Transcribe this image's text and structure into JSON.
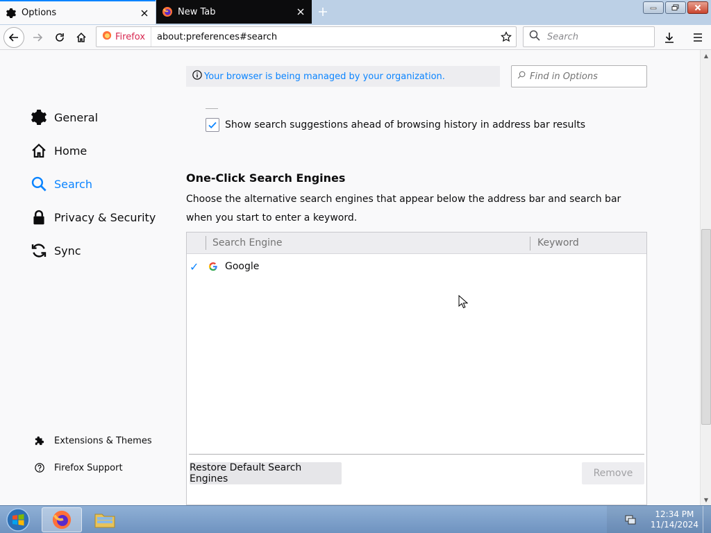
{
  "tabs": [
    {
      "label": "Options",
      "active": true
    },
    {
      "label": "New Tab",
      "active": false
    }
  ],
  "toolbar": {
    "identity_label": "Firefox",
    "url": "about:preferences#search",
    "search_placeholder": "Search"
  },
  "page": {
    "managed_notice": "Your browser is being managed by your organization.",
    "find_placeholder": "Find in Options",
    "suggestions_checkbox_label": "Show search suggestions ahead of browsing history in address bar results",
    "suggestions_checked": true,
    "section_title": "One-Click Search Engines",
    "section_description": "Choose the alternative search engines that appear below the address bar and search bar when you start to enter a keyword.",
    "table": {
      "columns": [
        "Search Engine",
        "Keyword"
      ],
      "rows": [
        {
          "enabled": true,
          "name": "Google",
          "keyword": ""
        }
      ]
    },
    "restore_button": "Restore Default Search Engines",
    "remove_button": "Remove"
  },
  "sidebar": {
    "categories": [
      {
        "label": "General",
        "icon": "gear-icon",
        "selected": false
      },
      {
        "label": "Home",
        "icon": "home-icon",
        "selected": false
      },
      {
        "label": "Search",
        "icon": "search-icon",
        "selected": true
      },
      {
        "label": "Privacy & Security",
        "icon": "lock-icon",
        "selected": false
      },
      {
        "label": "Sync",
        "icon": "sync-icon",
        "selected": false
      }
    ],
    "footer": [
      {
        "label": "Extensions & Themes",
        "icon": "puzzle-icon"
      },
      {
        "label": "Firefox Support",
        "icon": "help-icon"
      }
    ]
  },
  "taskbar": {
    "time": "12:34 PM",
    "date": "11/14/2024"
  },
  "colors": {
    "accent": "#0a84ff",
    "tabstrip": "#bcd0e6",
    "taskbar": "#6f93c0"
  }
}
